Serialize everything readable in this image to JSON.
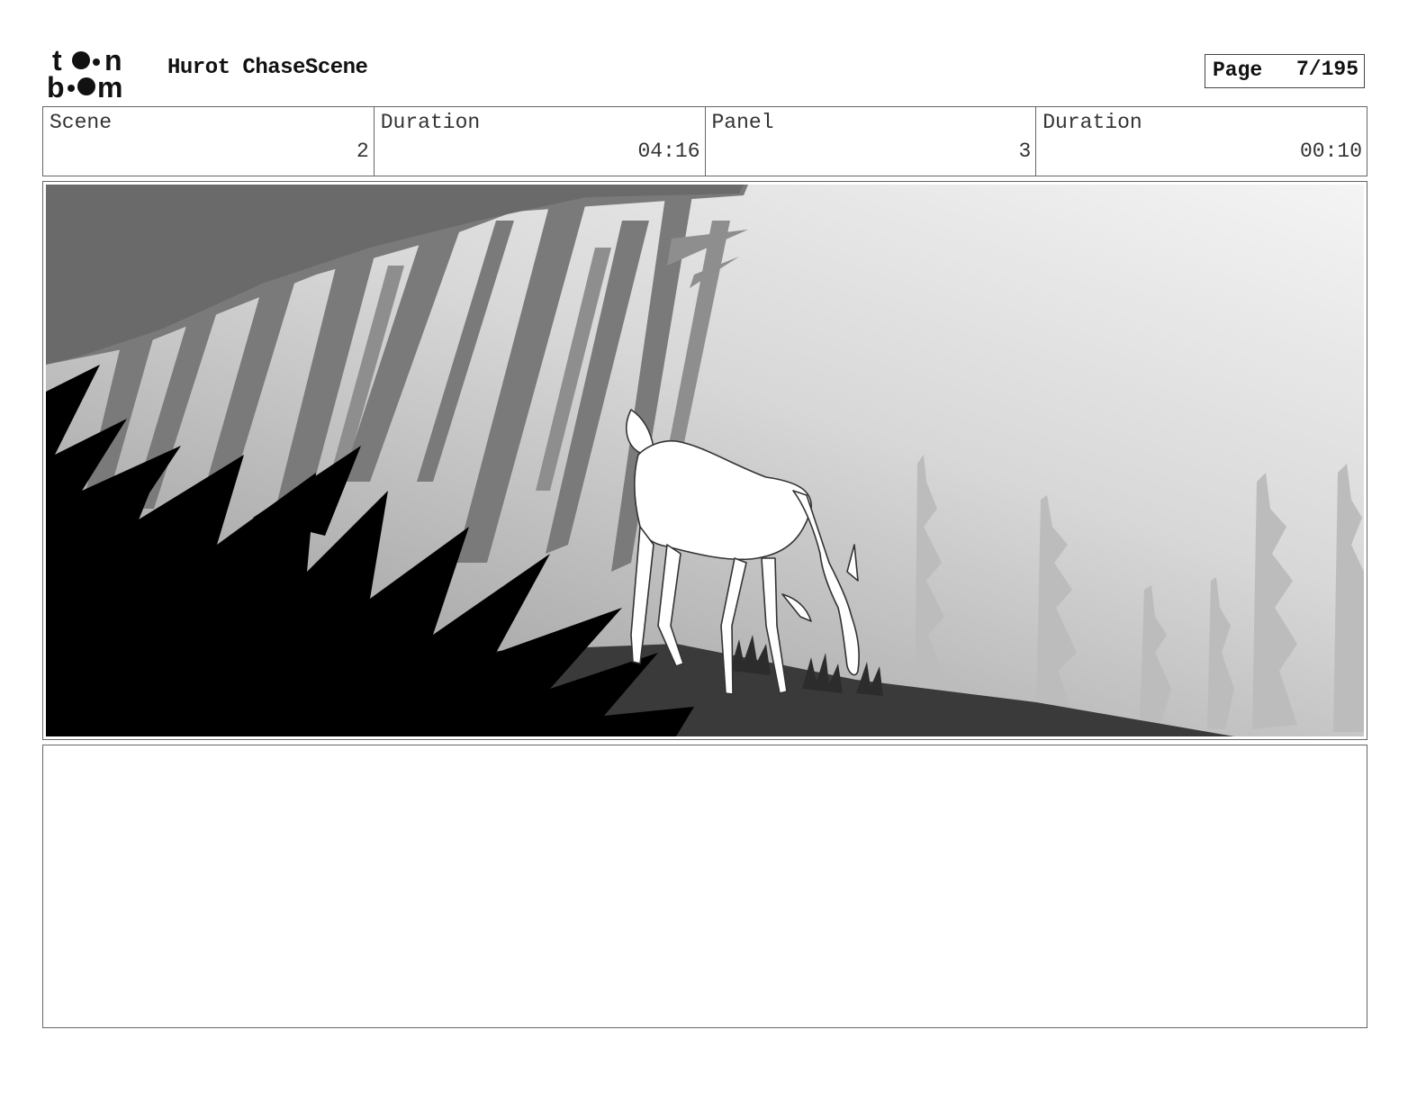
{
  "header": {
    "logo_text": "toon boom",
    "title": "Hurot ChaseScene",
    "page_label": "Page",
    "page_value": "7/195"
  },
  "info": {
    "scene_label": "Scene",
    "scene_value": "2",
    "scene_duration_label": "Duration",
    "scene_duration_value": "04:16",
    "panel_label": "Panel",
    "panel_value": "3",
    "panel_duration_label": "Duration",
    "panel_duration_value": "00:10"
  },
  "panel": {
    "description": "",
    "notes": ""
  },
  "colors": {
    "border": "#666666",
    "ink": "#000000",
    "sky_light": "#f2f2f2",
    "sky_dark": "#9a9a9a",
    "trees": "#6e6e6e"
  }
}
